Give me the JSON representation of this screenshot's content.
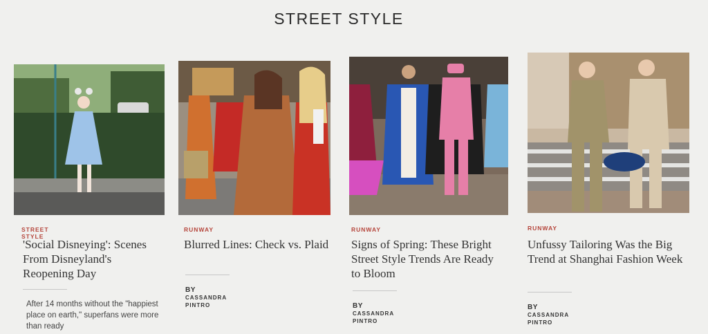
{
  "section": {
    "title": "STREET STYLE"
  },
  "cards": [
    {
      "kicker": "STREET STYLE",
      "headline": "'Social Disneying': Scenes From Disneyland's Reopening Day",
      "dek": "After 14 months without the \"happiest place on earth,\" superfans were more than ready",
      "byline": {
        "by": "",
        "name": ""
      },
      "photo_alt": "Woman in light blue dress and mask with Minnie ears"
    },
    {
      "kicker": "RUNWAY",
      "headline": "Blurred Lines: Check vs. Plaid",
      "dek": "",
      "byline": {
        "by": "BY",
        "name": "CASSANDRA PINTRO"
      },
      "photo_alt": "Group of people wearing plaid and check coats"
    },
    {
      "kicker": "RUNWAY",
      "headline": "Signs of Spring: These Bright Street Style Trends Are Ready to Bloom",
      "dek": "",
      "byline": {
        "by": "BY",
        "name": "CASSANDRA PINTRO"
      },
      "photo_alt": "People in bright blue coat and pink suit"
    },
    {
      "kicker": "RUNWAY",
      "headline": "Unfussy Tailoring Was the Big Trend at Shanghai Fashion Week",
      "dek": "",
      "byline": {
        "by": "BY",
        "name": "CASSANDRA PINTRO"
      },
      "photo_alt": "Two women in beige tailored suits"
    }
  ]
}
